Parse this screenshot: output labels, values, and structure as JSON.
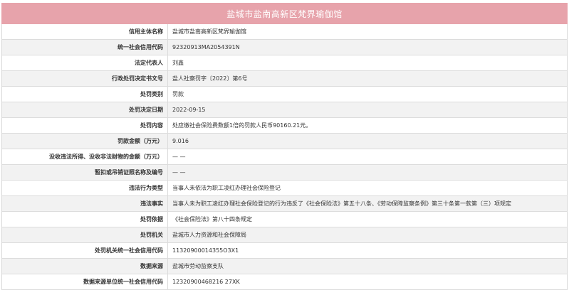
{
  "header": {
    "title": "盐城市盐南高新区梵界瑜伽馆"
  },
  "rows": [
    {
      "label": "信用主体名称",
      "value": "盐城市盐南高新区梵界瑜伽馆"
    },
    {
      "label": "统一社会信用代码",
      "value": "92320913MA2054391N"
    },
    {
      "label": "法定代表人",
      "value": "刘鑫"
    },
    {
      "label": "行政处罚决定书文号",
      "value": "盐人社察罚字〔2022〕第6号"
    },
    {
      "label": "处罚类别",
      "value": "罚款"
    },
    {
      "label": "处罚决定日期",
      "value": "2022-09-15"
    },
    {
      "label": "处罚内容",
      "value": "处应缴社会保险费数额1倍的罚款人民币90160.21元。"
    },
    {
      "label": "罚款金额（万元）",
      "value": "9.016"
    },
    {
      "label": "没收违法所得、没收非法财物的金额（万元）",
      "value": "— —"
    },
    {
      "label": "暂扣或吊销证照名称及编号",
      "value": "— —"
    },
    {
      "label": "违法行为类型",
      "value": "当事人未依法为职工凌红办理社会保险登记"
    },
    {
      "label": "违法事实",
      "value": "当事人未为职工凌红办理社会保险登记的行为违反了《社会保险法》第五十八条、《劳动保障监察条例》第三十条第一款第（三）项规定"
    },
    {
      "label": "处罚依据",
      "value": "《社会保险法》第八十四条规定"
    },
    {
      "label": "处罚机关",
      "value": "盐城市人力资源和社会保障局"
    },
    {
      "label": "处罚机关统一社会信用代码",
      "value": "11320900014355O3X1"
    },
    {
      "label": "数据来源",
      "value": "盐城市劳动监察支队"
    },
    {
      "label": "数据来源单位统一社会信用代码",
      "value": "12320900468216 27XK"
    }
  ],
  "colors": {
    "header_bg": "#e7a3ab",
    "row_alt_bg": "#f2f2f2",
    "border": "#dcdcdc"
  }
}
